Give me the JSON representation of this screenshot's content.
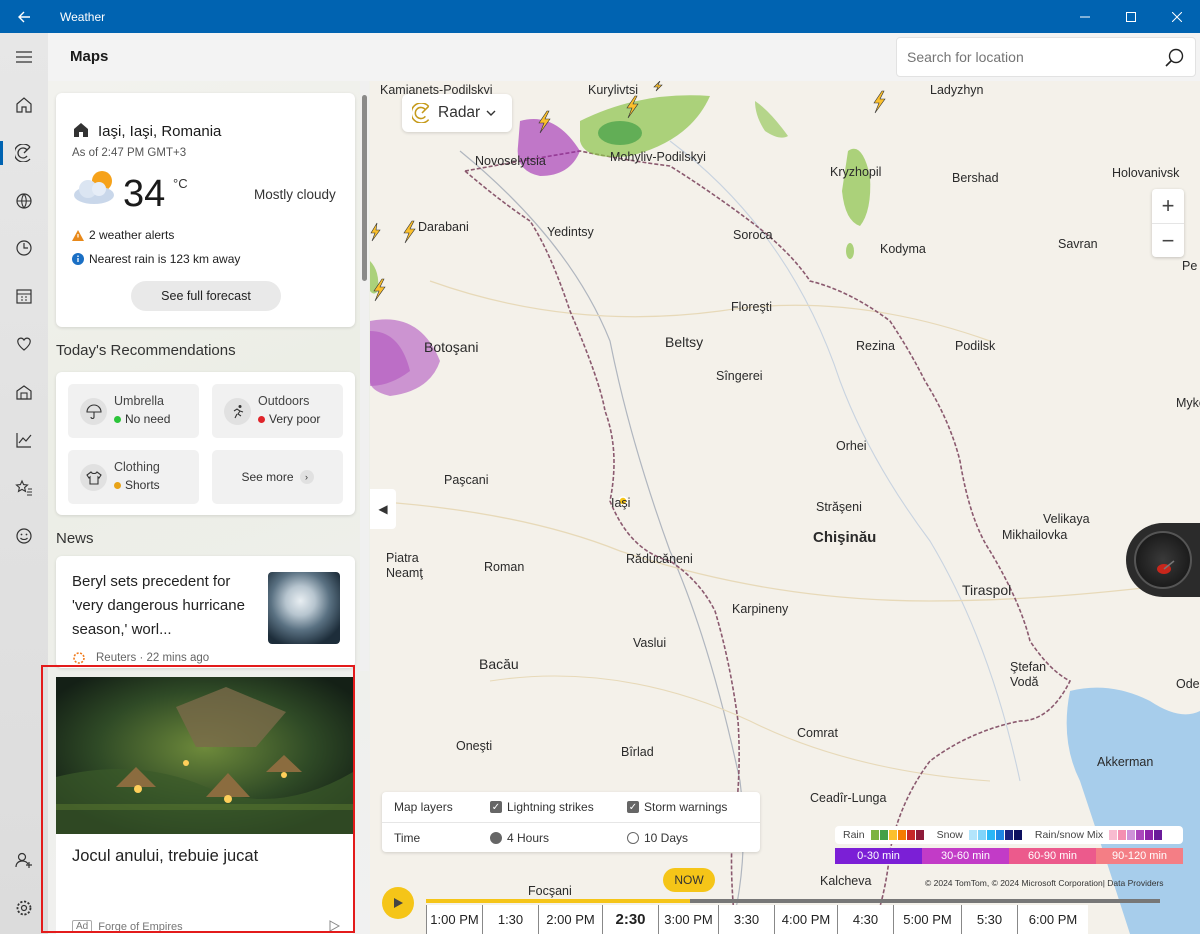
{
  "window": {
    "title": "Weather"
  },
  "header": {
    "page_title": "Maps",
    "search_placeholder": "Search for location"
  },
  "current": {
    "location": "Iaşi, Iaşi, Romania",
    "as_of": "As of 2:47 PM GMT+3",
    "temperature": "34",
    "unit": "°C",
    "condition": "Mostly cloudy",
    "alerts": "2 weather alerts",
    "rain": "Nearest rain is 123 km away",
    "forecast_button": "See full forecast"
  },
  "recommendations": {
    "title": "Today's Recommendations",
    "items": [
      {
        "label": "Umbrella",
        "value": "No need",
        "status_color": "#2bc43a"
      },
      {
        "label": "Outdoors",
        "value": "Very poor",
        "status_color": "#e0242a"
      },
      {
        "label": "Clothing",
        "value": "Shorts",
        "status_color": "#e8a317"
      }
    ],
    "see_more": "See more"
  },
  "news": {
    "title": "News",
    "article": {
      "headline": "Beryl sets precedent for 'very dangerous hurricane season,' worl...",
      "source": "Reuters · 22 mins ago"
    },
    "ad": {
      "title": "Jocul anului, trebuie jucat",
      "badge": "Ad",
      "advertiser": "Forge of Empires"
    }
  },
  "map": {
    "layer_selector": "Radar",
    "cities": [
      {
        "name": "Kamianets-Podilskyi",
        "cls": ""
      },
      {
        "name": "Kurylivtsi",
        "cls": ""
      },
      {
        "name": "Ladyzhyn",
        "cls": ""
      },
      {
        "name": "Novoselytsia",
        "cls": ""
      },
      {
        "name": "Mohyliv-Podilskyi",
        "cls": ""
      },
      {
        "name": "Holovanivsk",
        "cls": ""
      },
      {
        "name": "Kryzhopil",
        "cls": ""
      },
      {
        "name": "Bershad",
        "cls": ""
      },
      {
        "name": "Darabani",
        "cls": ""
      },
      {
        "name": "Yedintsy",
        "cls": ""
      },
      {
        "name": "Soroca",
        "cls": ""
      },
      {
        "name": "Kodyma",
        "cls": ""
      },
      {
        "name": "Savran",
        "cls": ""
      },
      {
        "name": "Pe",
        "cls": ""
      },
      {
        "name": "Floreşti",
        "cls": ""
      },
      {
        "name": "Botoşani",
        "cls": "mid"
      },
      {
        "name": "Beltsy",
        "cls": "mid"
      },
      {
        "name": "Rezina",
        "cls": ""
      },
      {
        "name": "Podilsk",
        "cls": ""
      },
      {
        "name": "Sîngerei",
        "cls": ""
      },
      {
        "name": "Myko",
        "cls": ""
      },
      {
        "name": "Orhei",
        "cls": ""
      },
      {
        "name": "Paşcani",
        "cls": ""
      },
      {
        "name": "Iaşi",
        "cls": ""
      },
      {
        "name": "Străşeni",
        "cls": ""
      },
      {
        "name": "Velikaya",
        "cls": ""
      },
      {
        "name": "Mikhailovka",
        "cls": ""
      },
      {
        "name": "Chişinău",
        "cls": "big"
      },
      {
        "name": "Piatra",
        "cls": ""
      },
      {
        "name": "Neamţ",
        "cls": ""
      },
      {
        "name": "Roman",
        "cls": ""
      },
      {
        "name": "Răducăneni",
        "cls": ""
      },
      {
        "name": "Tiraspol",
        "cls": "mid"
      },
      {
        "name": "Karpineny",
        "cls": ""
      },
      {
        "name": "Vaslui",
        "cls": ""
      },
      {
        "name": "Bacău",
        "cls": "mid"
      },
      {
        "name": "Ştefan",
        "cls": ""
      },
      {
        "name": "Vodă",
        "cls": ""
      },
      {
        "name": "Ode",
        "cls": ""
      },
      {
        "name": "Comrat",
        "cls": ""
      },
      {
        "name": "Oneşti",
        "cls": ""
      },
      {
        "name": "Bîrlad",
        "cls": ""
      },
      {
        "name": "Akkerman",
        "cls": ""
      },
      {
        "name": "Ceadîr-Lunga",
        "cls": ""
      },
      {
        "name": "Focşani",
        "cls": ""
      },
      {
        "name": "Kalcheva",
        "cls": ""
      }
    ],
    "layers": {
      "label": "Map layers",
      "lightning": "Lightning strikes",
      "storm": "Storm warnings",
      "time_label": "Time",
      "hours": "4 Hours",
      "days": "10 Days"
    },
    "legend": {
      "rain": "Rain",
      "snow": "Snow",
      "mix": "Rain/snow Mix",
      "rain_colors": [
        "#7cb342",
        "#43a047",
        "#fbc02d",
        "#f57c00",
        "#c62828",
        "#8e1b3a"
      ],
      "snow_colors": [
        "#b3e5fc",
        "#81d4fa",
        "#29b6f6",
        "#1e88e5",
        "#1a237e",
        "#0d1060"
      ],
      "mix_colors": [
        "#f8bbd0",
        "#f48fb1",
        "#ce93d8",
        "#ab47bc",
        "#8e24aa",
        "#6a1b9a"
      ],
      "bands": [
        {
          "label": "0-30 min",
          "color": "#7b1fd6"
        },
        {
          "label": "30-60 min",
          "color": "#c23bc7"
        },
        {
          "label": "60-90 min",
          "color": "#ec5a8c"
        },
        {
          "label": "90-120 min",
          "color": "#f47e85"
        }
      ]
    },
    "copyright": "© 2024 TomTom, © 2024 Microsoft Corporation|  Data Providers",
    "timeline": {
      "now_label": "NOW",
      "progress": 0.36,
      "ticks": [
        "1:00 PM",
        "1:30",
        "2:00 PM",
        "2:30",
        "3:00 PM",
        "3:30",
        "4:00 PM",
        "4:30",
        "5:00 PM",
        "5:30",
        "6:00 PM"
      ],
      "current_index": 3
    }
  }
}
